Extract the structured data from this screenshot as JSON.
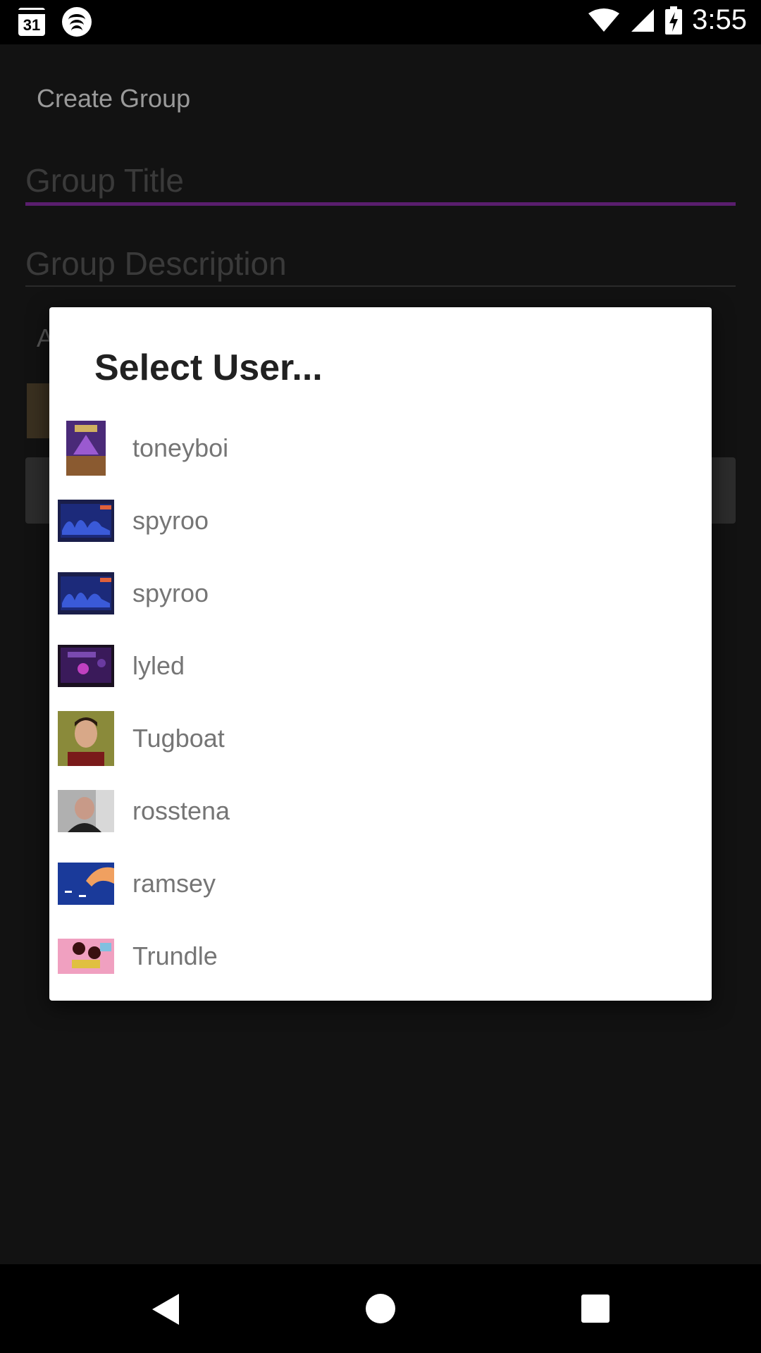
{
  "status_bar": {
    "calendar_day": "31",
    "time": "3:55",
    "icons": [
      "calendar-icon",
      "spotify-icon",
      "wifi-icon",
      "signal-icon",
      "battery-charging-icon"
    ]
  },
  "app": {
    "title": "Create Group",
    "group_title_placeholder": "Group Title",
    "group_description_placeholder": "Group Description",
    "partial_label": "A",
    "accent_color": "#5a1e6e"
  },
  "dialog": {
    "title": "Select User...",
    "users": [
      {
        "name": "toneyboi",
        "avatar": "game-cover-thumbnail"
      },
      {
        "name": "spyroo",
        "avatar": "chart-screen-thumbnail"
      },
      {
        "name": "spyroo",
        "avatar": "chart-screen-thumbnail"
      },
      {
        "name": "lyled",
        "avatar": "purple-screen-thumbnail"
      },
      {
        "name": "Tugboat",
        "avatar": "person-photo-thumbnail"
      },
      {
        "name": "rosstena",
        "avatar": "person-photo-thumbnail"
      },
      {
        "name": "ramsey",
        "avatar": "blue-illustration-thumbnail"
      },
      {
        "name": "Trundle",
        "avatar": "cartoon-thumbnail"
      }
    ]
  },
  "nav_bar": {
    "icons": [
      "back-icon",
      "home-icon",
      "recent-apps-icon"
    ]
  }
}
